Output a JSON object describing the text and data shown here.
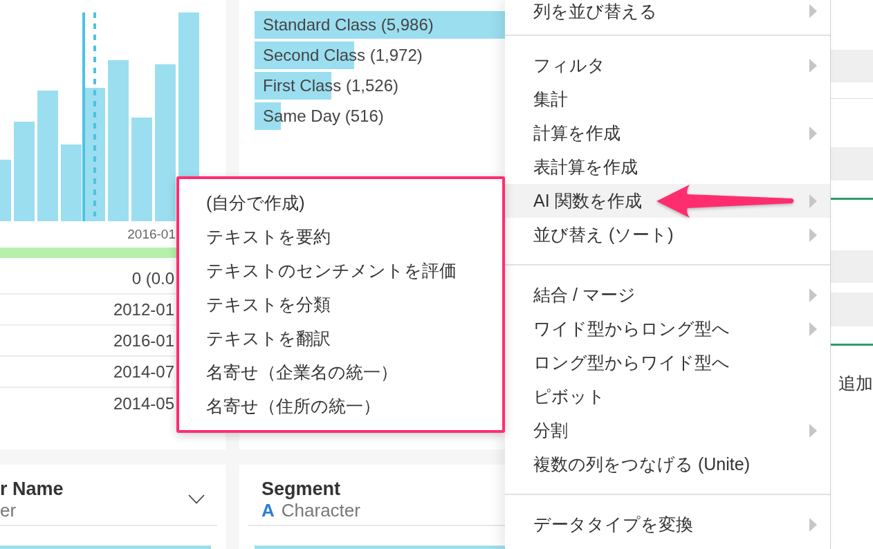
{
  "histogram_card": {
    "axis_label": "2016-01",
    "summary_rows": [
      "0 (0.0",
      "2012-01",
      "2016-01",
      "2014-07",
      "2014-05"
    ]
  },
  "ship_mode_card": {
    "bars": [
      {
        "label": "Standard Class (5,986)",
        "level": 1
      },
      {
        "label": "Second Class (1,972)",
        "level": 0.33
      },
      {
        "label": "First Class (1,526)",
        "level": 0.255
      },
      {
        "label": "Same Day (516)",
        "level": 0.086
      }
    ]
  },
  "column_cards": [
    {
      "title": "r Name",
      "type_label": "er",
      "menu_icon": true
    },
    {
      "title": "Segment",
      "type_icon": "A",
      "type_label": "Character",
      "menu_icon": false
    }
  ],
  "right_panel": {
    "text": "追加"
  },
  "context_menu": {
    "groups": [
      {
        "items": [
          {
            "label": "列を並び替える",
            "has_submenu": true,
            "selected": false
          }
        ]
      },
      {
        "items": [
          {
            "label": "フィルタ",
            "has_submenu": true,
            "selected": false
          },
          {
            "label": "集計",
            "has_submenu": false,
            "selected": false
          },
          {
            "label": "計算を作成",
            "has_submenu": true,
            "selected": false
          },
          {
            "label": "表計算を作成",
            "has_submenu": false,
            "selected": false
          },
          {
            "label": "AI 関数を作成",
            "has_submenu": true,
            "selected": true
          },
          {
            "label": "並び替え (ソート)",
            "has_submenu": true,
            "selected": false
          }
        ]
      },
      {
        "items": [
          {
            "label": "結合 / マージ",
            "has_submenu": true,
            "selected": false
          },
          {
            "label": "ワイド型からロング型へ",
            "has_submenu": true,
            "selected": false
          },
          {
            "label": "ロング型からワイド型へ",
            "has_submenu": false,
            "selected": false
          },
          {
            "label": "ピボット",
            "has_submenu": false,
            "selected": false
          },
          {
            "label": "分割",
            "has_submenu": true,
            "selected": false
          },
          {
            "label": "複数の列をつなげる (Unite)",
            "has_submenu": false,
            "selected": false
          }
        ]
      },
      {
        "items": [
          {
            "label": "データタイプを変換",
            "has_submenu": true,
            "selected": false
          }
        ]
      }
    ]
  },
  "submenu": {
    "items": [
      "(自分で作成)",
      "テキストを要約",
      "テキストのセンチメントを評価",
      "テキストを分類",
      "テキストを翻訳",
      "名寄せ（企業名の統一）",
      "名寄せ（住所の統一）"
    ]
  }
}
